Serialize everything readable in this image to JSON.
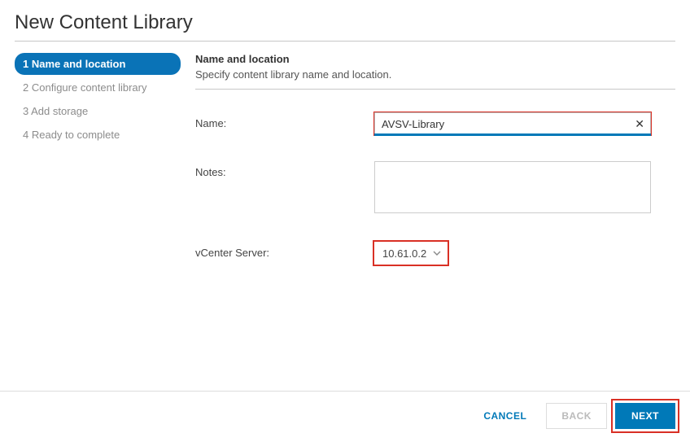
{
  "dialog": {
    "title": "New Content Library"
  },
  "steps": [
    {
      "label": "1 Name and location",
      "active": true
    },
    {
      "label": "2 Configure content library",
      "active": false
    },
    {
      "label": "3 Add storage",
      "active": false
    },
    {
      "label": "4 Ready to complete",
      "active": false
    }
  ],
  "section": {
    "heading": "Name and location",
    "description": "Specify content library name and location."
  },
  "form": {
    "name_label": "Name:",
    "name_value": "AVSV-Library",
    "notes_label": "Notes:",
    "notes_value": "",
    "vcenter_label": "vCenter Server:",
    "vcenter_value": "10.61.0.2"
  },
  "footer": {
    "cancel": "CANCEL",
    "back": "BACK",
    "next": "NEXT"
  }
}
